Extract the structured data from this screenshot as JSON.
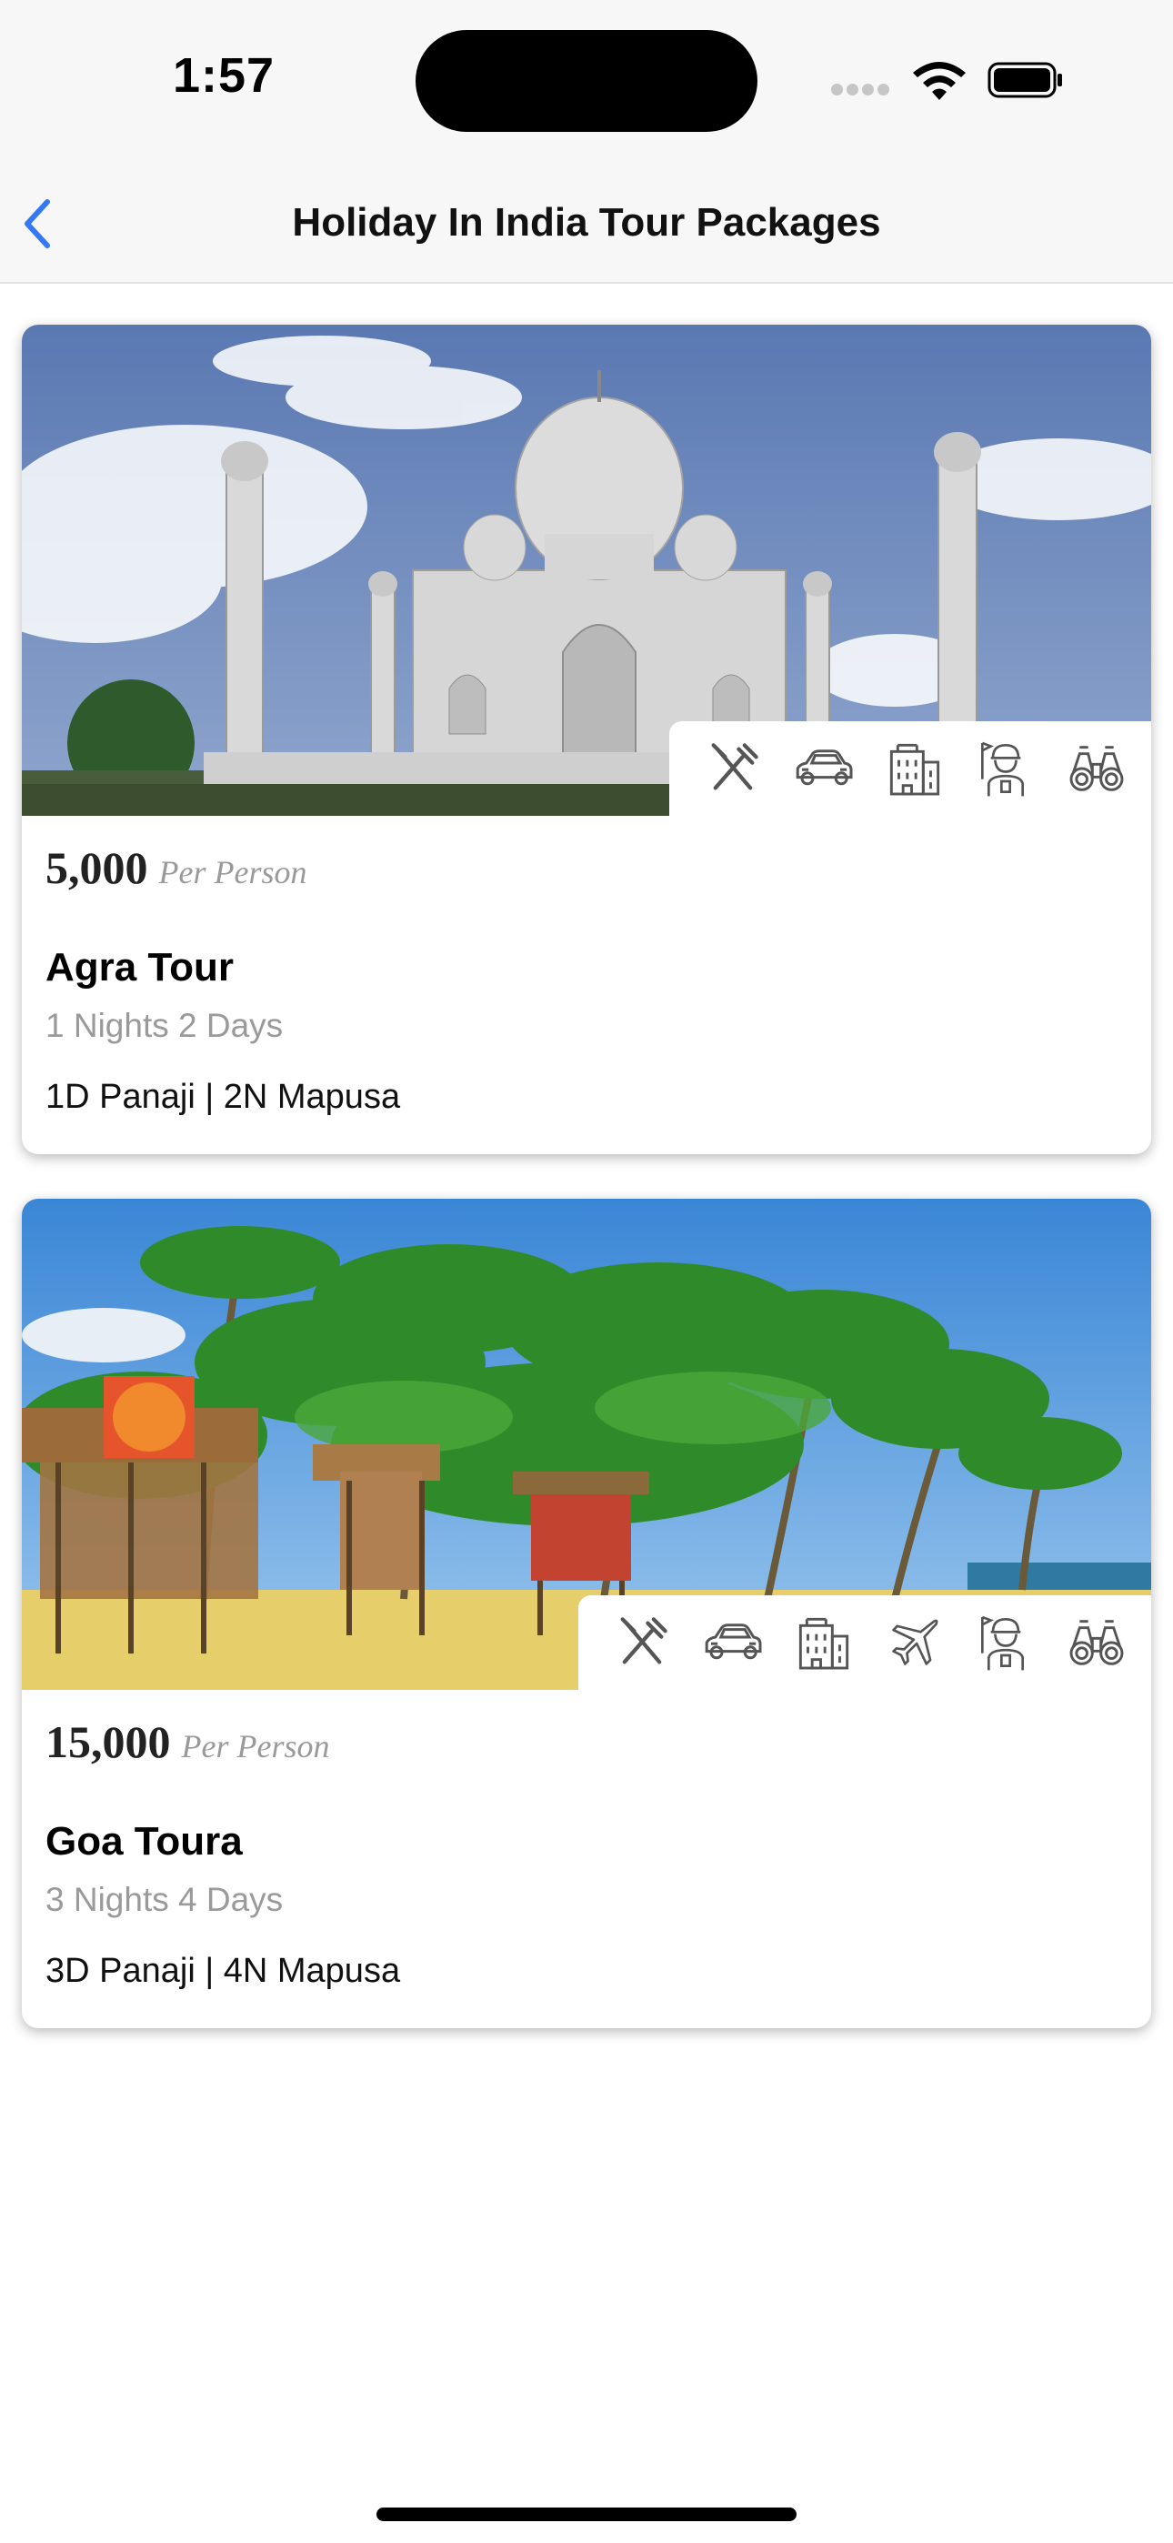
{
  "status": {
    "time": "1:57"
  },
  "nav": {
    "title": "Holiday In India Tour Packages",
    "back_icon": "chevron-left-icon"
  },
  "colors": {
    "accent": "#3478f6",
    "muted": "#9a9a9a"
  },
  "packages": [
    {
      "image": "taj-mahal-photo",
      "price": "5,000",
      "price_unit": "Per Person",
      "name": "Agra Tour",
      "duration": "1 Nights 2 Days",
      "route": "1D Panaji | 2N Mapusa",
      "amenities": [
        "meals-icon",
        "car-icon",
        "hotel-icon",
        "guide-icon",
        "sightseeing-icon"
      ]
    },
    {
      "image": "goa-beach-photo",
      "price": "15,000",
      "price_unit": "Per Person",
      "name": "Goa Toura",
      "duration": "3 Nights 4 Days",
      "route": "3D Panaji | 4N Mapusa",
      "amenities": [
        "meals-icon",
        "car-icon",
        "hotel-icon",
        "flight-icon",
        "guide-icon",
        "sightseeing-icon"
      ]
    }
  ]
}
